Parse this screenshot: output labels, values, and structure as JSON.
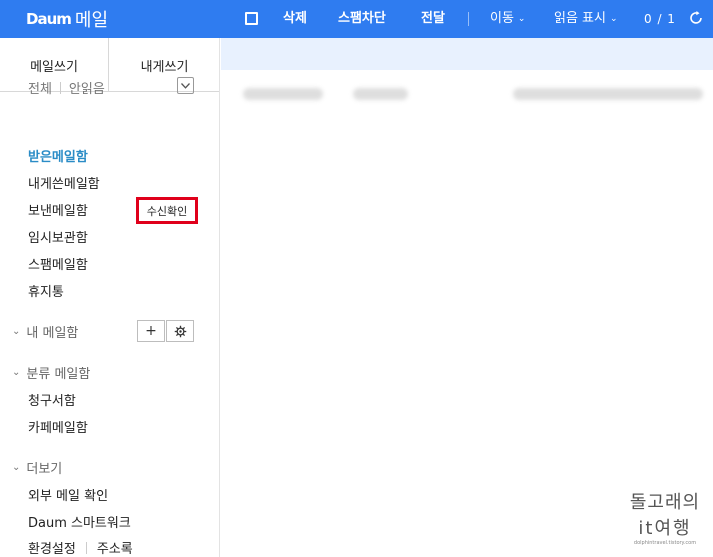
{
  "header": {
    "logo_brand": "Daum",
    "logo_service": "메일",
    "toolbar": {
      "delete": "삭제",
      "spam_block": "스팸차단",
      "forward": "전달",
      "move": "이동",
      "mark_read": "읽음 표시"
    },
    "counter": "0 / 1"
  },
  "sidebar": {
    "write_mail": "메일쓰기",
    "write_self": "내게쓰기",
    "filter_all": "전체",
    "filter_unread": "안읽음",
    "mailboxes": [
      {
        "label": "받은메일함",
        "active": true
      },
      {
        "label": "내게쓴메일함"
      },
      {
        "label": "보낸메일함"
      },
      {
        "label": "임시보관함"
      },
      {
        "label": "스팸메일함"
      },
      {
        "label": "휴지통"
      }
    ],
    "read_receipt": "수신확인",
    "my_mailbox": "내 메일함",
    "categories": {
      "title": "분류 메일함",
      "items": [
        "청구서함",
        "카페메일함"
      ]
    },
    "more": {
      "title": "더보기",
      "items": [
        "외부 메일 확인",
        "Daum 스마트워크"
      ]
    },
    "settings": "환경설정",
    "address_book": "주소록"
  },
  "watermark": {
    "line1": "돌고래의",
    "line2": "it여행",
    "url": "dolphintravel.tistory.com"
  },
  "colors": {
    "header_bg": "#2f7cf0",
    "active_mailbox": "#2a8cc6",
    "highlight_box": "#e0001b"
  }
}
